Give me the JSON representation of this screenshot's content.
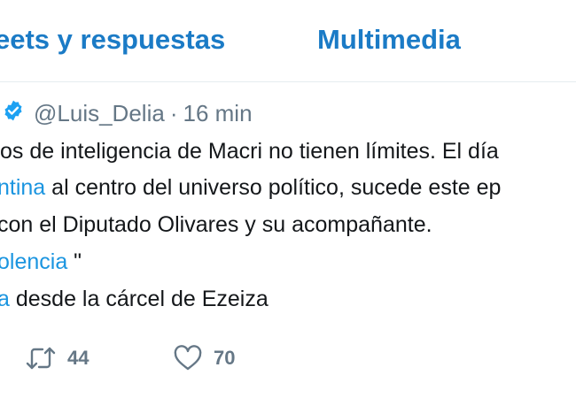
{
  "tabs": [
    {
      "label": "eets y respuestas"
    },
    {
      "label": "Multimedia"
    }
  ],
  "tweet": {
    "handle": "@Luis_Delia",
    "separator": "·",
    "time": "16 min",
    "lines": [
      [
        {
          "text": "os de inteligencia de Macri no tienen límites. El día",
          "link": false
        }
      ],
      [
        {
          "text": "ntina",
          "link": true
        },
        {
          "text": " al centro del universo político, sucede este ep",
          "link": false
        }
      ],
      [
        {
          "text": " con el Diputado  Olivares y su acompañante.",
          "link": false
        }
      ],
      [
        {
          "text": "olencia",
          "link": true
        },
        {
          "text": " \"",
          "link": false
        }
      ],
      [
        {
          "text": "a",
          "link": true
        },
        {
          "text": " desde la cárcel de Ezeiza",
          "link": false
        }
      ]
    ],
    "retweet_count": "44",
    "like_count": "70"
  },
  "icons": {
    "verified": "verified-badge-icon",
    "retweet": "retweet-icon",
    "like": "heart-icon"
  },
  "colors": {
    "accent": "#1b7bc6",
    "link": "#1b95e0",
    "muted": "#657786",
    "verified": "#1da1f2"
  }
}
